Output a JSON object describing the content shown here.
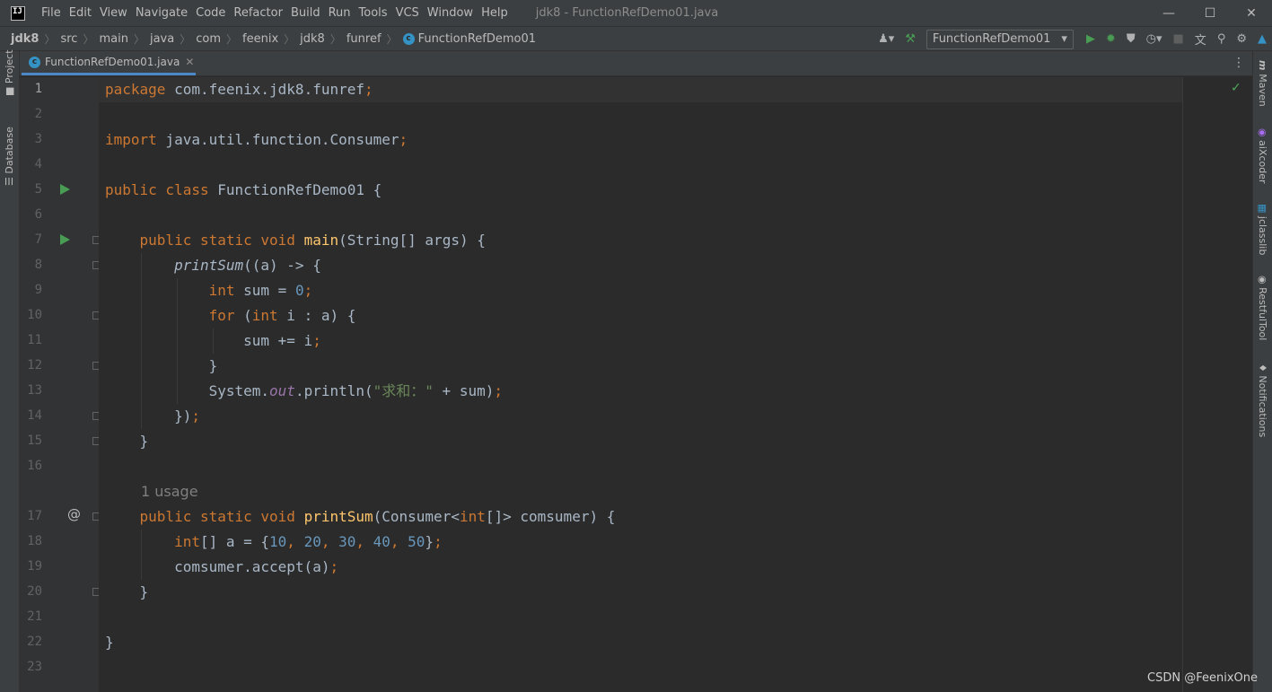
{
  "menubar": {
    "items": [
      "File",
      "Edit",
      "View",
      "Navigate",
      "Code",
      "Refactor",
      "Build",
      "Run",
      "Tools",
      "VCS",
      "Window",
      "Help"
    ],
    "title": "jdk8 - FunctionRefDemo01.java"
  },
  "breadcrumb": {
    "items": [
      "jdk8",
      "src",
      "main",
      "java",
      "com",
      "feenix",
      "jdk8",
      "funref"
    ],
    "file": "FunctionRefDemo01"
  },
  "toolbar": {
    "run_config": "FunctionRefDemo01"
  },
  "left_tools": [
    "Project",
    "Database"
  ],
  "right_tools": [
    "Maven",
    "aiXcoder",
    "jclasslib",
    "RestfulTool",
    "Notifications"
  ],
  "tab": {
    "label": "FunctionRefDemo01.java"
  },
  "editor": {
    "line_numbers": [
      "1",
      "2",
      "3",
      "4",
      "5",
      "6",
      "7",
      "8",
      "9",
      "10",
      "11",
      "12",
      "13",
      "14",
      "15",
      "16",
      "17",
      "18",
      "19",
      "20",
      "21",
      "22",
      "23"
    ],
    "current_line": 1,
    "usage_hint": "1 usage",
    "code": {
      "l1_kw": "package",
      "l1_rest": " com.feenix.jdk8.funref",
      "l3_kw": "import",
      "l3_rest": " java.util.function.Consumer",
      "l5_kw": "public class",
      "l5_rest": " FunctionRefDemo01 {",
      "l7_kw": "public static void",
      "l7_fn": "main",
      "l7_rest": "(String[] args) {",
      "l8_fn": "printSum",
      "l8_rest": "((a) -> {",
      "l9_kw": "int",
      "l9_rest": " sum = ",
      "l9_num": "0",
      "l10_kw1": "for",
      "l10_mid": " (",
      "l10_kw2": "int",
      "l10_rest": " i : a) {",
      "l11_rest": "sum += i",
      "l12_rest": "}",
      "l13_a": "System.",
      "l13_field": "out",
      "l13_b": ".println(",
      "l13_str": "\"求和：\"",
      "l13_c": " + sum)",
      "l14_rest": "})",
      "l15_rest": "}",
      "l17_kw": "public static void",
      "l17_fn": "printSum",
      "l17_a": "(Consumer<",
      "l17_kw2": "int",
      "l17_b": "[]> comsumer) {",
      "l18_kw": "int",
      "l18_a": "[] a = {",
      "l18_n1": "10",
      "l18_n2": "20",
      "l18_n3": "30",
      "l18_n4": "40",
      "l18_n5": "50",
      "l18_b": "}",
      "l19_rest": "comsumer.accept(a)",
      "l20_rest": "}",
      "l22_rest": "}"
    }
  },
  "watermark": "CSDN @FeenixOne",
  "colors": {
    "keyword": "#cc7832",
    "number": "#6897bb",
    "string": "#6a8759",
    "function": "#ffc66d",
    "field": "#9876aa",
    "run_green": "#499c54"
  }
}
